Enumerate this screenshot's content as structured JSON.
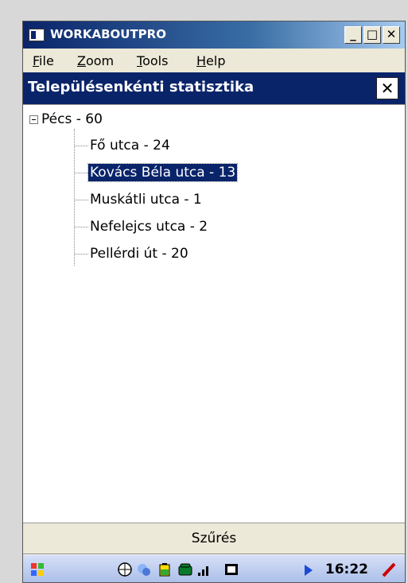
{
  "window": {
    "title": "WORKABOUTPRO",
    "minimize_label": "_",
    "maximize_label": "□",
    "close_label": "✕"
  },
  "menu": {
    "items": [
      {
        "label": "File",
        "accel": "F",
        "rest": "ile"
      },
      {
        "label": "Zoom",
        "accel": "Z",
        "rest": "oom"
      },
      {
        "label": "Tools",
        "accel": "T",
        "rest": "ools"
      },
      {
        "label": "Help",
        "accel": "H",
        "rest": "elp"
      }
    ]
  },
  "dialog": {
    "title": "Településenkénti statisztika",
    "close_label": "✕"
  },
  "tree": {
    "root": {
      "label": "Pécs - 60",
      "expanded": true
    },
    "children": [
      {
        "label": "Fő utca - 24",
        "selected": false
      },
      {
        "label": "Kovács Béla utca - 13",
        "selected": true
      },
      {
        "label": "Muskátli utca - 1",
        "selected": false
      },
      {
        "label": "Nefelejcs utca - 2",
        "selected": false
      },
      {
        "label": "Pellérdi út - 20",
        "selected": false
      }
    ]
  },
  "filter_button": {
    "label": "Szűrés"
  },
  "taskbar": {
    "time": "16:22",
    "icons": [
      "windows-start-icon",
      "network-globe-icon",
      "sync-icon",
      "battery-icon",
      "phone-icon",
      "signal-icon",
      "keyboard-icon",
      "pen-icon"
    ]
  },
  "colors": {
    "title_bar": "#0a246a",
    "selection": "#0a246a"
  }
}
